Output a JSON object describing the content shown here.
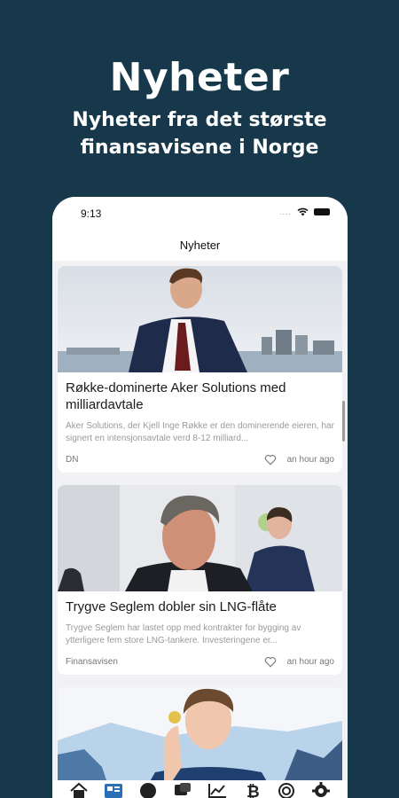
{
  "promo": {
    "title": "Nyheter",
    "subtitle_line1": "Nyheter fra det største",
    "subtitle_line2": "finansavisene i Norge"
  },
  "statusbar": {
    "time": "9:13",
    "dots": "...."
  },
  "navbar": {
    "title": "Nyheter"
  },
  "articles": [
    {
      "title": "Røkke-dominerte Aker Solutions med milliardavtale",
      "summary": "Aker Solutions, der Kjell Inge Røkke er den dominerende eieren, har signert en intensjonsavtale verd 8-12 milliard...",
      "source": "DN",
      "time": "an hour ago"
    },
    {
      "title": "Trygve Seglem dobler sin LNG-flåte",
      "summary": "Trygve Seglem har lastet opp med kontrakter for bygging av ytterligere fem store LNG-tankere. Investeringene er...",
      "source": "Finansavisen",
      "time": "an hour ago"
    }
  ],
  "tabs": [
    "home-icon",
    "news-icon",
    "chat-icon",
    "messages-icon",
    "chart-icon",
    "bitcoin-icon",
    "target-icon",
    "settings-icon"
  ],
  "colors": {
    "background": "#16384a",
    "accent": "#2d6fb5"
  }
}
